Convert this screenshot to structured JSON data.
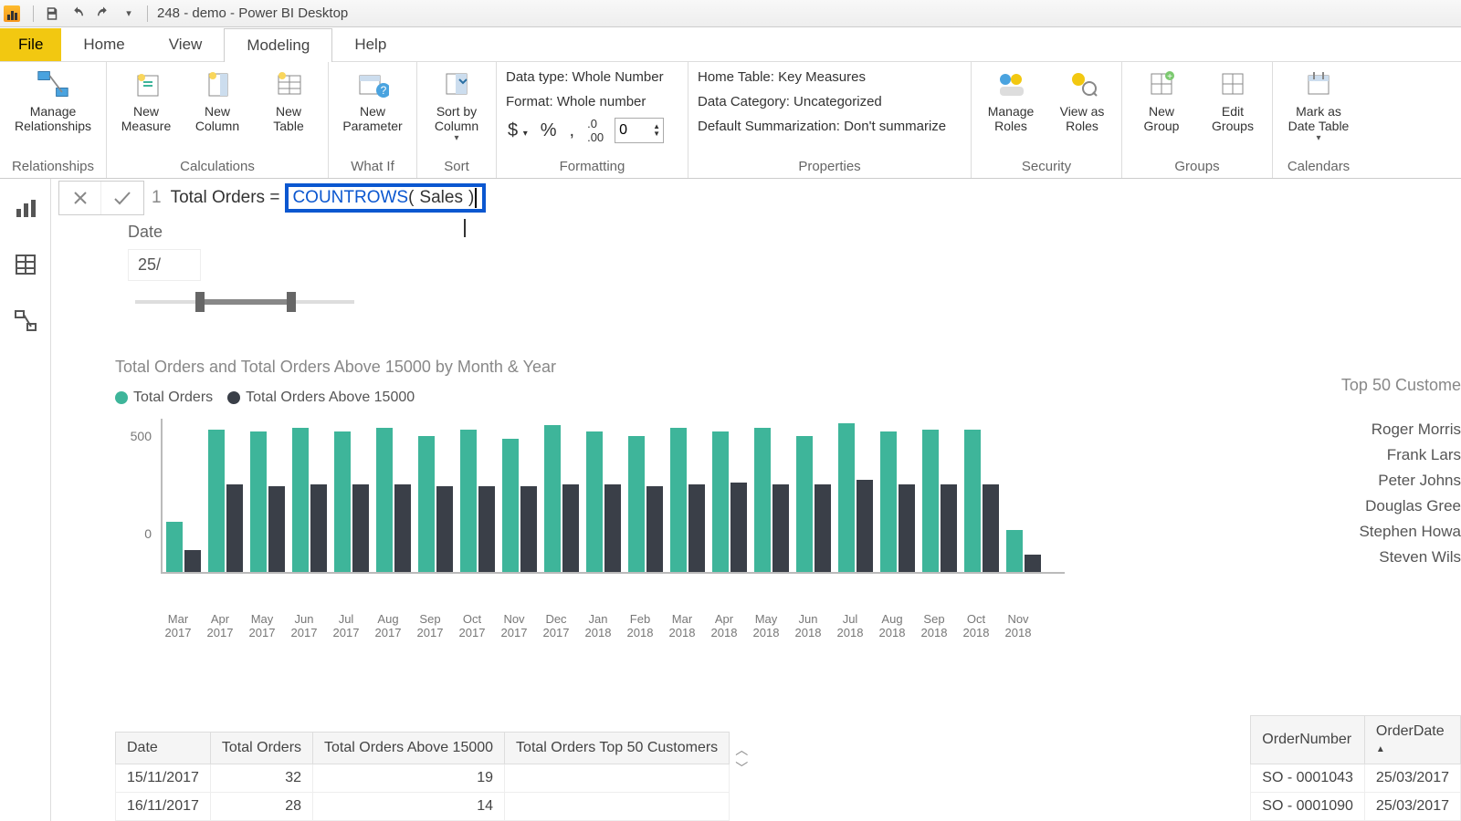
{
  "title": "248 - demo - Power BI Desktop",
  "menus": {
    "file": "File",
    "home": "Home",
    "view": "View",
    "modeling": "Modeling",
    "help": "Help"
  },
  "ribbon": {
    "relationships": {
      "manage": "Manage\nRelationships",
      "group": "Relationships"
    },
    "calculations": {
      "measure": "New\nMeasure",
      "column": "New\nColumn",
      "table": "New\nTable",
      "group": "Calculations"
    },
    "whatif": {
      "param": "New\nParameter",
      "group": "What If"
    },
    "sort": {
      "sortby": "Sort by\nColumn",
      "group": "Sort"
    },
    "formatting": {
      "datatype": "Data type: Whole Number",
      "format": "Format: Whole number",
      "decimal": "0",
      "group": "Formatting"
    },
    "properties": {
      "hometable": "Home Table: Key Measures",
      "datacategory": "Data Category: Uncategorized",
      "summarization": "Default Summarization: Don't summarize",
      "group": "Properties"
    },
    "security": {
      "manage": "Manage\nRoles",
      "view": "View as\nRoles",
      "group": "Security"
    },
    "groups": {
      "new": "New\nGroup",
      "edit": "Edit\nGroups",
      "group": "Groups"
    },
    "calendars": {
      "mark": "Mark as\nDate Table",
      "group": "Calendars"
    }
  },
  "formula": {
    "line": "1",
    "prefix": "Total Orders =",
    "fn": "COUNTROWS",
    "arg": "Sales"
  },
  "slicer": {
    "title": "Date",
    "value": "25/"
  },
  "chart": {
    "title": "Total Orders and Total Orders Above 15000 by Month & Year",
    "legend_a": "Total Orders",
    "legend_b": "Total Orders Above 15000",
    "y500": "500",
    "y0": "0"
  },
  "chart_data": {
    "type": "bar",
    "title": "Total Orders and Total Orders Above 15000 by Month & Year",
    "xlabel": "Month & Year",
    "ylabel": "",
    "ylim": [
      0,
      700
    ],
    "categories": [
      "Mar 2017",
      "Apr 2017",
      "May 2017",
      "Jun 2017",
      "Jul 2017",
      "Aug 2017",
      "Sep 2017",
      "Oct 2017",
      "Nov 2017",
      "Dec 2017",
      "Jan 2018",
      "Feb 2018",
      "Mar 2018",
      "Apr 2018",
      "May 2018",
      "Jun 2018",
      "Jul 2018",
      "Aug 2018",
      "Sep 2018",
      "Oct 2018",
      "Nov 2018"
    ],
    "series": [
      {
        "name": "Total Orders",
        "values": [
          230,
          650,
          640,
          660,
          640,
          660,
          620,
          650,
          610,
          670,
          640,
          620,
          660,
          640,
          660,
          620,
          680,
          640,
          650,
          650,
          190
        ]
      },
      {
        "name": "Total Orders Above 15000",
        "values": [
          100,
          400,
          390,
          400,
          400,
          400,
          390,
          390,
          390,
          400,
          400,
          390,
          400,
          410,
          400,
          400,
          420,
          400,
          400,
          400,
          80
        ]
      }
    ]
  },
  "rightlist": {
    "title": "Top 50 Custome",
    "items": [
      "Roger Morris",
      "Frank Lars",
      "Peter Johns",
      "Douglas Gree",
      "Stephen Howa",
      "Steven Wils"
    ]
  },
  "table1": {
    "h1": "Date",
    "h2": "Total Orders",
    "h3": "Total Orders Above 15000",
    "h4": "Total Orders Top 50 Customers",
    "r1c1": "15/11/2017",
    "r1c2": "32",
    "r1c3": "19",
    "r2c1": "16/11/2017",
    "r2c2": "28",
    "r2c3": "14"
  },
  "table2": {
    "h1": "OrderNumber",
    "h2": "OrderDate",
    "r1c1": "SO - 0001043",
    "r1c2": "25/03/2017",
    "r2c1": "SO - 0001090",
    "r2c2": "25/03/2017"
  }
}
